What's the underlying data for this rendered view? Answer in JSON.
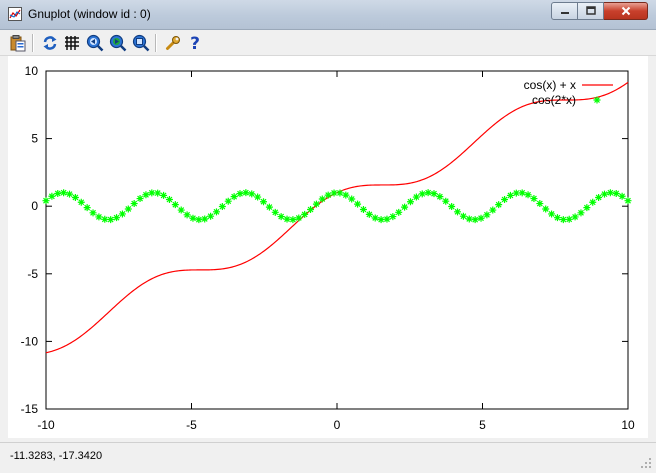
{
  "window": {
    "title": "Gnuplot (window id : 0)",
    "buttons": {
      "minimize": "minimize-icon",
      "maximize": "maximize-icon",
      "close": "close-icon"
    }
  },
  "toolbar": {
    "items": [
      {
        "name": "copy-to-clipboard-button",
        "icon": "clipboard-icon"
      },
      {
        "name": "replot-button",
        "icon": "refresh-icon"
      },
      {
        "name": "grid-button",
        "icon": "grid-icon"
      },
      {
        "name": "zoom-previous-button",
        "icon": "zoom-previous-icon"
      },
      {
        "name": "zoom-next-button",
        "icon": "zoom-next-icon"
      },
      {
        "name": "autoscale-button",
        "icon": "autoscale-icon"
      },
      {
        "name": "options-button",
        "icon": "wrench-icon"
      },
      {
        "name": "help-button",
        "icon": "help-icon"
      }
    ]
  },
  "status": {
    "coordinates": "-11.3283, -17.3420"
  },
  "colors": {
    "series1": "#ff0000",
    "series2": "#00ff00",
    "axis": "#000000"
  },
  "chart_data": {
    "type": "line",
    "xlim": [
      -10,
      10
    ],
    "ylim": [
      -15,
      10
    ],
    "xticks": [
      "-10",
      "-5",
      "0",
      "5",
      "10"
    ],
    "xtick_values": [
      -10,
      -5,
      0,
      5,
      10
    ],
    "yticks": [
      "10",
      "5",
      "0",
      "-5",
      "-10",
      "-15"
    ],
    "ytick_values": [
      10,
      5,
      0,
      -5,
      -10,
      -15
    ],
    "grid": false,
    "legend_position": "top-right",
    "series": [
      {
        "name": "cos(x) + x",
        "style": "line",
        "color": "#ff0000",
        "x": [
          -10,
          -9,
          -8,
          -7,
          -6,
          -5,
          -4,
          -3,
          -2,
          -1,
          0,
          1,
          2,
          3,
          4,
          5,
          6,
          7,
          8,
          9,
          10
        ],
        "y": [
          -10.84,
          -9.91,
          -8.15,
          -6.25,
          -5.04,
          -4.72,
          -4.65,
          -3.99,
          -2.42,
          -0.46,
          1.0,
          1.54,
          1.58,
          2.01,
          3.35,
          5.28,
          6.96,
          7.75,
          7.85,
          8.09,
          9.16
        ]
      },
      {
        "name": "cos(2*x)",
        "style": "points",
        "color": "#00ff00",
        "x": [
          -10,
          -9,
          -8,
          -7,
          -6,
          -5,
          -4,
          -3,
          -2,
          -1,
          0,
          1,
          2,
          3,
          4,
          5,
          6,
          7,
          8,
          9,
          10
        ],
        "y": [
          0.41,
          0.66,
          -0.96,
          0.14,
          0.84,
          -0.84,
          -0.15,
          0.96,
          -0.65,
          -0.42,
          1.0,
          -0.42,
          -0.65,
          0.96,
          -0.15,
          -0.84,
          0.84,
          0.14,
          -0.96,
          0.66,
          0.41
        ]
      }
    ]
  }
}
